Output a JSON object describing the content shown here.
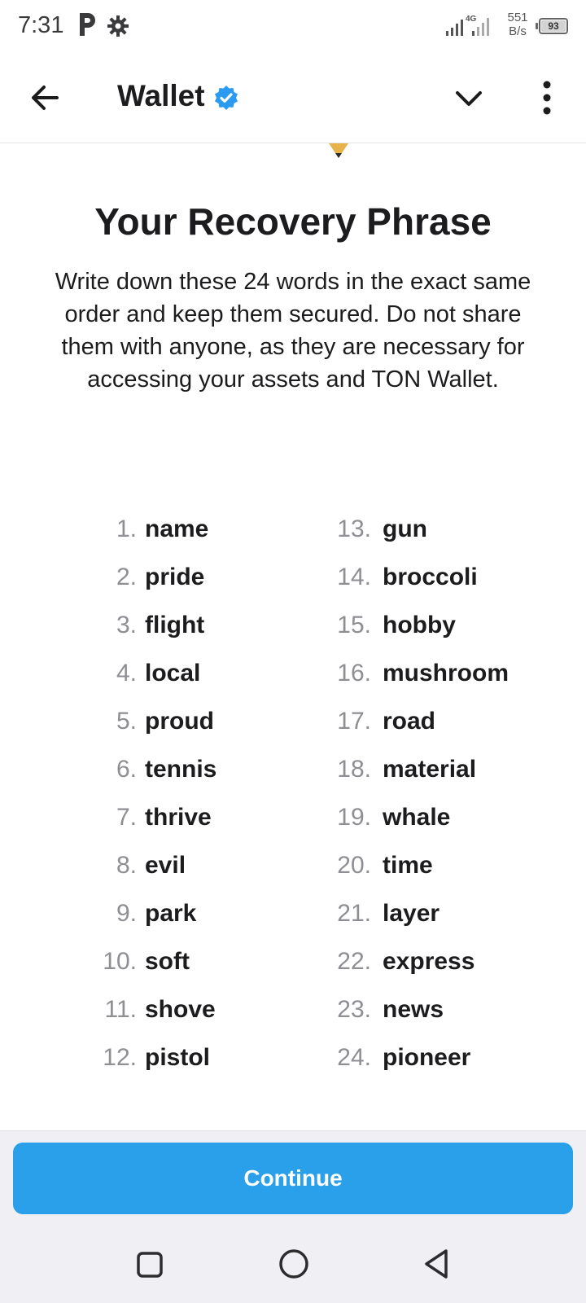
{
  "status_bar": {
    "time": "7:31",
    "network_type": "4G",
    "speed_value": "551",
    "speed_unit": "B/s",
    "battery": "93"
  },
  "header": {
    "title": "Wallet",
    "icons": {
      "back": "arrow-left-icon",
      "verified": "verified-badge-icon",
      "dropdown": "chevron-down-icon",
      "menu": "more-vertical-icon"
    }
  },
  "content": {
    "title": "Your Recovery Phrase",
    "description": "Write down these 24 words in the exact same order and keep them secured. Do not share them with anyone, as they are necessary for accessing your assets and TON Wallet.",
    "words": [
      {
        "num": "1.",
        "word": "name"
      },
      {
        "num": "2.",
        "word": "pride"
      },
      {
        "num": "3.",
        "word": "flight"
      },
      {
        "num": "4.",
        "word": "local"
      },
      {
        "num": "5.",
        "word": "proud"
      },
      {
        "num": "6.",
        "word": "tennis"
      },
      {
        "num": "7.",
        "word": "thrive"
      },
      {
        "num": "8.",
        "word": "evil"
      },
      {
        "num": "9.",
        "word": "park"
      },
      {
        "num": "10.",
        "word": "soft"
      },
      {
        "num": "11.",
        "word": "shove"
      },
      {
        "num": "12.",
        "word": "pistol"
      },
      {
        "num": "13.",
        "word": "gun"
      },
      {
        "num": "14.",
        "word": "broccoli"
      },
      {
        "num": "15.",
        "word": "hobby"
      },
      {
        "num": "16.",
        "word": "mushroom"
      },
      {
        "num": "17.",
        "word": "road"
      },
      {
        "num": "18.",
        "word": "material"
      },
      {
        "num": "19.",
        "word": "whale"
      },
      {
        "num": "20.",
        "word": "time"
      },
      {
        "num": "21.",
        "word": "layer"
      },
      {
        "num": "22.",
        "word": "express"
      },
      {
        "num": "23.",
        "word": "news"
      },
      {
        "num": "24.",
        "word": "pioneer"
      }
    ]
  },
  "footer": {
    "continue_label": "Continue"
  },
  "colors": {
    "accent": "#2aa0eb",
    "verified": "#2a9bf0",
    "text": "#1c1c1e",
    "muted": "#8e8e93"
  }
}
